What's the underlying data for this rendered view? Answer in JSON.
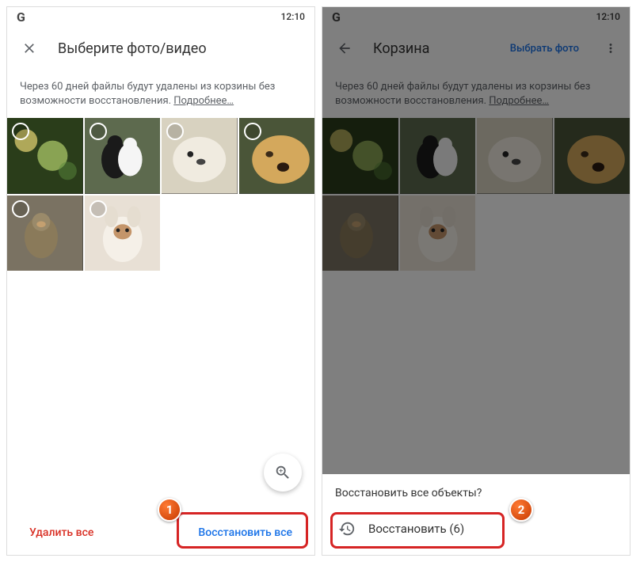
{
  "status": {
    "time": "12:10",
    "logo": "G"
  },
  "left": {
    "title": "Выберите фото/видео",
    "info": "Через 60 дней файлы будут удалены из корзины без возможности восстановления.",
    "info_link": "Подробнее…",
    "delete_all": "Удалить все",
    "restore_all": "Восстановить все"
  },
  "right": {
    "title": "Корзина",
    "select_photo": "Выбрать фото",
    "info": "Через 60 дней файлы будут удалены из корзины без возможности восстановления.",
    "info_link": "Подробнее…",
    "sheet_title": "Восстановить все объекты?",
    "sheet_action": "Восстановить (6)"
  },
  "badges": {
    "one": "1",
    "two": "2"
  }
}
